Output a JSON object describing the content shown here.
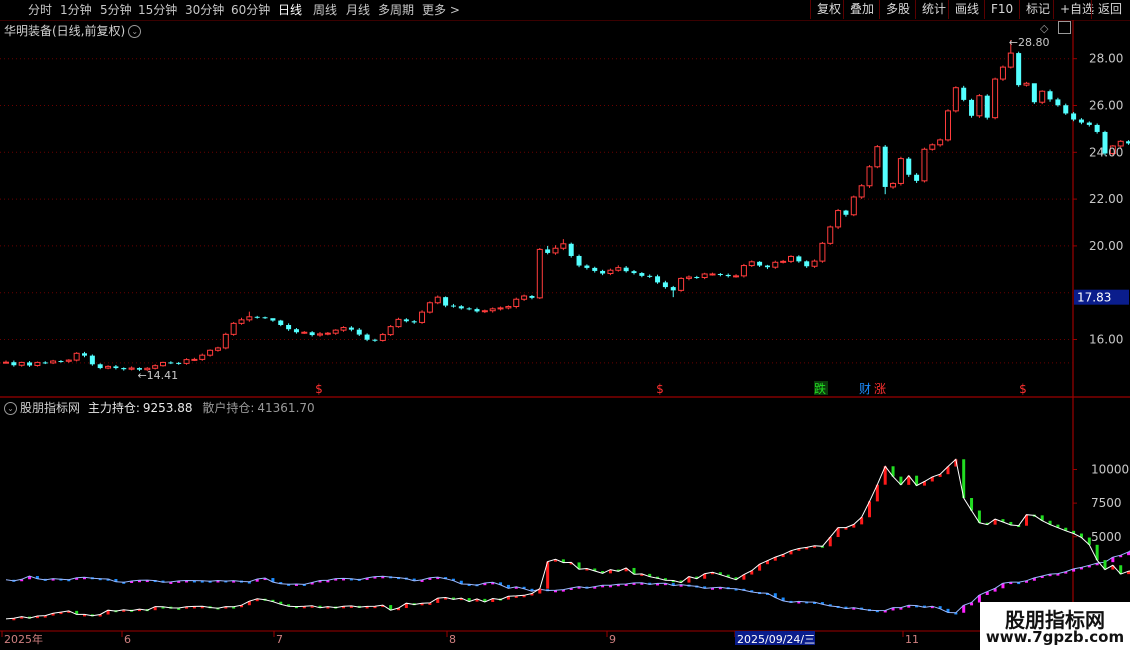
{
  "toolbar": {
    "left_items": [
      {
        "label": "分时",
        "active": false
      },
      {
        "label": "1分钟",
        "active": false
      },
      {
        "label": "5分钟",
        "active": false
      },
      {
        "label": "15分钟",
        "active": false
      },
      {
        "label": "30分钟",
        "active": false
      },
      {
        "label": "60分钟",
        "active": false
      },
      {
        "label": "日线",
        "active": true
      },
      {
        "label": "周线",
        "active": false
      },
      {
        "label": "月线",
        "active": false
      },
      {
        "label": "多周期",
        "active": false
      },
      {
        "label": "更多 >",
        "active": false
      }
    ],
    "right_items": [
      "复权",
      "叠加",
      "多股",
      "统计",
      "画线",
      "F10",
      "标记",
      "+自选",
      "返回"
    ]
  },
  "main_chart": {
    "title": "华明装备(日线,前复权)",
    "price_axis": [
      "28.00",
      "26.00",
      "24.00",
      "22.00",
      "20.00",
      "16.00"
    ],
    "current_price": "17.83",
    "high_marker": "28.80",
    "low_marker": "14.41",
    "event_markers": [
      "$",
      "$",
      "跌",
      "财",
      "涨",
      "$"
    ],
    "chart_data": {
      "type": "candlestick",
      "ylim": [
        14.0,
        29.2
      ],
      "opens": [
        15.03,
        15.03,
        14.9,
        15.02,
        14.89,
        15.02,
        15.0,
        15.08,
        15.07,
        15.12,
        15.41,
        15.31,
        14.94,
        14.78,
        14.85,
        14.78,
        14.73,
        14.78,
        14.71,
        14.77,
        14.88,
        15.02,
        15.0,
        14.98,
        15.14,
        15.15,
        15.33,
        15.54,
        15.64,
        16.22,
        16.69,
        16.84,
        16.97,
        16.95,
        16.91,
        16.81,
        16.62,
        16.44,
        16.31,
        16.31,
        16.19,
        16.24,
        16.27,
        16.4,
        16.51,
        16.42,
        16.21,
        15.99,
        15.96,
        16.21,
        16.55,
        16.86,
        16.78,
        16.73,
        17.17,
        17.57,
        17.81,
        17.45,
        17.42,
        17.33,
        17.3,
        17.2,
        17.23,
        17.31,
        17.35,
        17.41,
        17.72,
        17.86,
        17.78,
        19.85,
        19.7,
        19.9,
        20.09,
        19.57,
        19.16,
        19.06,
        18.93,
        18.82,
        18.96,
        19.07,
        18.92,
        18.84,
        18.72,
        18.7,
        18.44,
        18.24,
        18.1,
        18.61,
        18.67,
        18.65,
        18.8,
        18.8,
        18.76,
        18.71,
        18.72,
        19.16,
        19.32,
        19.16,
        19.09,
        19.3,
        19.34,
        19.55,
        19.34,
        19.13,
        19.35,
        20.11,
        20.81,
        21.51,
        21.33,
        22.09,
        22.57,
        23.38,
        24.24,
        22.52,
        22.67,
        23.73,
        23.04,
        22.78,
        24.13,
        24.32,
        24.53,
        25.77,
        26.76,
        26.24,
        25.56,
        26.42,
        25.48,
        27.13,
        27.64,
        28.24,
        26.87,
        26.95,
        26.14,
        26.61,
        26.26,
        26.01,
        25.66,
        25.4,
        25.27,
        25.17,
        24.87,
        23.95,
        24.27,
        24.47,
        24.38,
        24.36,
        24.17
      ],
      "closes": [
        15.03,
        14.9,
        15.02,
        14.89,
        15.02,
        15.0,
        15.08,
        15.07,
        15.12,
        15.41,
        15.31,
        14.94,
        14.78,
        14.85,
        14.78,
        14.73,
        14.78,
        14.71,
        14.77,
        14.88,
        15.02,
        15.0,
        14.98,
        15.14,
        15.15,
        15.33,
        15.54,
        15.64,
        16.22,
        16.69,
        16.84,
        16.97,
        16.95,
        16.91,
        16.81,
        16.62,
        16.44,
        16.31,
        16.31,
        16.19,
        16.24,
        16.27,
        16.4,
        16.51,
        16.42,
        16.21,
        15.99,
        15.96,
        16.21,
        16.55,
        16.86,
        16.78,
        16.73,
        17.17,
        17.57,
        17.81,
        17.45,
        17.42,
        17.33,
        17.3,
        17.2,
        17.23,
        17.31,
        17.35,
        17.41,
        17.72,
        17.86,
        17.78,
        19.85,
        19.7,
        19.9,
        20.09,
        19.57,
        19.16,
        19.06,
        18.93,
        18.82,
        18.96,
        19.07,
        18.92,
        18.84,
        18.72,
        18.7,
        18.44,
        18.24,
        18.1,
        18.61,
        18.67,
        18.65,
        18.8,
        18.8,
        18.76,
        18.71,
        18.72,
        19.16,
        19.32,
        19.16,
        19.09,
        19.3,
        19.34,
        19.55,
        19.34,
        19.13,
        19.35,
        20.11,
        20.81,
        21.51,
        21.33,
        22.09,
        22.57,
        23.38,
        24.24,
        22.52,
        22.67,
        23.73,
        23.04,
        22.78,
        24.13,
        24.32,
        24.53,
        25.77,
        26.76,
        26.24,
        25.56,
        26.42,
        25.48,
        27.13,
        27.64,
        28.24,
        26.87,
        26.95,
        26.14,
        26.61,
        26.26,
        26.01,
        25.66,
        25.4,
        25.27,
        25.17,
        24.87,
        23.95,
        24.27,
        24.47,
        24.38,
        24.36,
        24.17,
        24.48
      ],
      "highs": [
        15.1,
        15.1,
        15.05,
        15.08,
        15.06,
        15.07,
        15.13,
        15.12,
        15.16,
        15.46,
        15.47,
        15.36,
        14.98,
        14.9,
        14.91,
        14.81,
        14.85,
        14.81,
        14.82,
        14.94,
        15.05,
        15.07,
        15.04,
        15.2,
        15.22,
        15.4,
        15.58,
        15.69,
        16.29,
        16.75,
        16.93,
        17.19,
        17.01,
        16.98,
        16.87,
        16.84,
        16.69,
        16.49,
        16.36,
        16.36,
        16.32,
        16.32,
        16.44,
        16.57,
        16.57,
        16.49,
        16.26,
        16.03,
        16.28,
        16.62,
        16.93,
        16.91,
        16.83,
        17.25,
        17.63,
        17.88,
        17.84,
        17.52,
        17.47,
        17.38,
        17.36,
        17.28,
        17.37,
        17.41,
        17.46,
        17.79,
        17.92,
        17.9,
        19.91,
        20.0,
        20.03,
        20.29,
        20.14,
        19.63,
        19.21,
        19.11,
        18.98,
        19.03,
        19.17,
        19.14,
        18.97,
        18.88,
        18.78,
        18.77,
        18.51,
        18.29,
        18.66,
        18.74,
        18.72,
        18.85,
        18.86,
        18.84,
        18.82,
        18.79,
        19.23,
        19.38,
        19.35,
        19.19,
        19.37,
        19.4,
        19.6,
        19.6,
        19.38,
        19.42,
        20.17,
        20.87,
        21.58,
        21.54,
        22.15,
        22.64,
        23.45,
        24.31,
        24.31,
        22.72,
        23.81,
        23.8,
        23.11,
        24.2,
        24.38,
        24.59,
        25.84,
        26.82,
        26.84,
        26.29,
        26.49,
        26.48,
        27.19,
        27.71,
        28.8,
        28.3,
        27.01,
        26.94,
        26.65,
        26.68,
        26.33,
        26.08,
        25.72,
        25.46,
        25.32,
        25.23,
        24.92,
        24.31,
        24.52,
        24.52,
        24.44,
        24.41,
        24.54
      ],
      "lows": [
        14.99,
        14.84,
        14.84,
        14.83,
        14.84,
        14.95,
        14.95,
        15.01,
        15.0,
        15.06,
        15.24,
        14.88,
        14.73,
        14.73,
        14.72,
        14.67,
        14.68,
        14.65,
        14.66,
        14.72,
        14.84,
        14.95,
        14.92,
        14.92,
        15.08,
        15.09,
        15.27,
        15.48,
        15.58,
        16.16,
        16.63,
        16.76,
        16.89,
        16.88,
        16.76,
        16.57,
        16.37,
        16.25,
        16.24,
        16.13,
        16.12,
        16.18,
        16.2,
        16.33,
        16.35,
        16.15,
        15.93,
        15.9,
        15.91,
        16.15,
        16.5,
        16.73,
        16.67,
        16.67,
        17.11,
        17.51,
        17.38,
        17.36,
        17.28,
        17.25,
        17.15,
        17.13,
        17.15,
        17.24,
        17.29,
        17.33,
        17.65,
        17.72,
        17.73,
        19.64,
        19.62,
        19.82,
        19.5,
        19.09,
        18.99,
        18.86,
        18.75,
        18.75,
        18.9,
        18.86,
        18.78,
        18.66,
        18.63,
        18.38,
        18.17,
        17.81,
        18.04,
        18.53,
        18.59,
        18.58,
        18.73,
        18.7,
        18.65,
        18.64,
        18.65,
        19.1,
        19.1,
        19.01,
        19.02,
        19.25,
        19.27,
        19.28,
        19.06,
        19.06,
        19.28,
        20.05,
        20.72,
        21.25,
        21.27,
        22.01,
        22.48,
        23.32,
        22.21,
        22.44,
        22.58,
        22.95,
        22.69,
        22.71,
        24.07,
        24.24,
        24.46,
        25.7,
        26.18,
        25.48,
        25.47,
        25.4,
        25.41,
        27.05,
        27.58,
        26.8,
        26.81,
        26.07,
        26.06,
        26.16,
        25.95,
        25.6,
        25.33,
        25.2,
        25.1,
        24.8,
        23.87,
        23.87,
        24.19,
        24.32,
        24.29,
        24.08,
        24.09
      ]
    }
  },
  "indicator": {
    "name": "股朋指标网",
    "main_label": "主力持仓:",
    "main_value": "9253.88",
    "retail_label": "散户持仓:",
    "retail_value": "41361.70",
    "axis": [
      "10000",
      "7500",
      "5000"
    ],
    "chart_data": {
      "type": "line",
      "ylim": [
        -1500,
        12000
      ],
      "series": [
        {
          "values": [
            -1110,
            -1060,
            -940,
            -1050,
            -890,
            -860,
            -690,
            -600,
            -510,
            -770,
            -770,
            -870,
            -780,
            -460,
            -530,
            -430,
            -490,
            -380,
            -460,
            -190,
            -200,
            -290,
            -300,
            -200,
            -180,
            -170,
            -260,
            -310,
            -190,
            -200,
            -90,
            210,
            390,
            310,
            170,
            -20,
            -160,
            -190,
            -170,
            -130,
            -280,
            -190,
            -270,
            -170,
            -140,
            -230,
            -180,
            -160,
            -80,
            -460,
            -300,
            60,
            -40,
            50,
            80,
            440,
            480,
            340,
            440,
            180,
            380,
            150,
            410,
            330,
            570,
            600,
            650,
            780,
            1140,
            3150,
            3320,
            3080,
            3090,
            2590,
            2640,
            2450,
            2280,
            2560,
            2430,
            2680,
            2210,
            2240,
            2030,
            1920,
            1770,
            1750,
            1590,
            2040,
            1880,
            2250,
            2360,
            2180,
            1990,
            1810,
            2190,
            2480,
            2960,
            3220,
            3490,
            3690,
            3960,
            4130,
            4210,
            4330,
            4290,
            4980,
            5680,
            5680,
            5920,
            6450,
            7630,
            8870,
            10240,
            9470,
            8860,
            9540,
            8800,
            9110,
            9450,
            9650,
            10220,
            10760,
            7880,
            6950,
            6040,
            5900,
            6310,
            6100,
            5870,
            5820,
            6640,
            6590,
            6190,
            5900,
            5670,
            5440,
            5240,
            4940,
            4400,
            3260,
            2560,
            2880,
            2220,
            2440,
            2530,
            2530,
            2490
          ]
        },
        {
          "values": [
            1800,
            1720,
            1840,
            2080,
            1870,
            1790,
            1890,
            1840,
            1810,
            1950,
            1990,
            1920,
            1880,
            1860,
            1650,
            1610,
            1710,
            1770,
            1780,
            1740,
            1620,
            1640,
            1720,
            1750,
            1740,
            1730,
            1690,
            1750,
            1700,
            1740,
            1670,
            1660,
            1860,
            1930,
            1630,
            1500,
            1470,
            1490,
            1460,
            1600,
            1750,
            1760,
            1890,
            1900,
            1870,
            1810,
            1940,
            2040,
            2060,
            2000,
            1960,
            1890,
            1720,
            1790,
            1950,
            2000,
            1880,
            1730,
            1490,
            1470,
            1400,
            1560,
            1610,
            1420,
            1160,
            1280,
            1130,
            950,
            1100,
            1000,
            1020,
            1070,
            1190,
            1290,
            1190,
            1290,
            1390,
            1390,
            1470,
            1490,
            1570,
            1580,
            1460,
            1530,
            1550,
            1370,
            1440,
            1370,
            1310,
            1160,
            1210,
            1250,
            1150,
            1130,
            1020,
            890,
            820,
            800,
            480,
            230,
            130,
            190,
            150,
            140,
            -20,
            -150,
            -200,
            -340,
            -270,
            -380,
            -460,
            -490,
            -480,
            -270,
            -270,
            -100,
            -120,
            -250,
            -160,
            -360,
            -630,
            -650,
            -100,
            110,
            670,
            920,
            1170,
            1550,
            1630,
            1620,
            1730,
            1940,
            2080,
            2220,
            2260,
            2410,
            2610,
            2720,
            2880,
            3040,
            3110,
            3480,
            3630,
            3870,
            4220,
            4260,
            4080,
            3920
          ]
        }
      ]
    }
  },
  "time_axis": [
    "2025年",
    "6",
    "7",
    "8",
    "9",
    "2025/09/24/三",
    "11"
  ],
  "watermark": {
    "line1": "股朋指标网",
    "line2": "www.7gpzb.com"
  },
  "colors": {
    "up": "#ff3c3c",
    "down": "#54ffff",
    "main_up": "#ff1a1a",
    "main_down": "#22dd22",
    "retail_up": "#ff22ff",
    "retail_down": "#1c8cff",
    "grid": "#6b0000"
  }
}
